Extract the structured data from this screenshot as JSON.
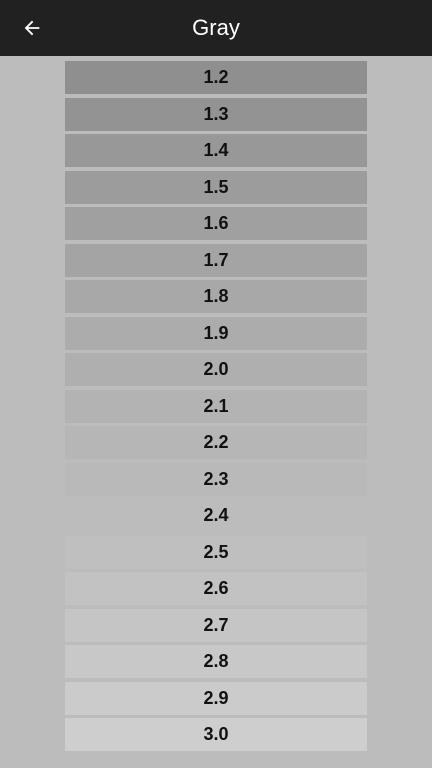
{
  "header": {
    "title": "Gray",
    "back_icon": "arrow-back-icon"
  },
  "colors": {
    "app_bar": "#212121",
    "background": "#bcbcbc",
    "text": "#111111"
  },
  "items": [
    {
      "label": "1.2",
      "color": "#8f8f8f"
    },
    {
      "label": "1.3",
      "color": "#939393"
    },
    {
      "label": "1.4",
      "color": "#989898"
    },
    {
      "label": "1.5",
      "color": "#9c9c9c"
    },
    {
      "label": "1.6",
      "color": "#a0a0a0"
    },
    {
      "label": "1.7",
      "color": "#a4a4a4"
    },
    {
      "label": "1.8",
      "color": "#a8a8a8"
    },
    {
      "label": "1.9",
      "color": "#acacac"
    },
    {
      "label": "2.0",
      "color": "#afafaf"
    },
    {
      "label": "2.1",
      "color": "#b3b3b3"
    },
    {
      "label": "2.2",
      "color": "#b6b6b6"
    },
    {
      "label": "2.3",
      "color": "#b9b9b9"
    },
    {
      "label": "2.4",
      "color": "#bcbcbc"
    },
    {
      "label": "2.5",
      "color": "#bfbfbf"
    },
    {
      "label": "2.6",
      "color": "#c2c2c2"
    },
    {
      "label": "2.7",
      "color": "#c5c5c5"
    },
    {
      "label": "2.8",
      "color": "#c8c8c8"
    },
    {
      "label": "2.9",
      "color": "#cbcbcb"
    },
    {
      "label": "3.0",
      "color": "#cecece"
    }
  ]
}
